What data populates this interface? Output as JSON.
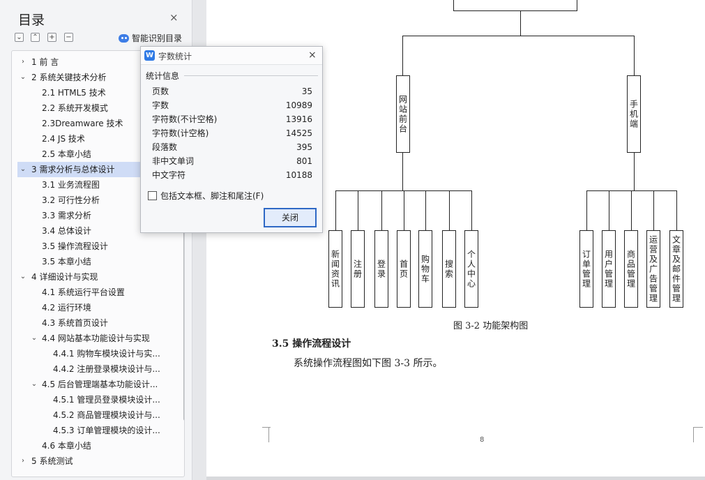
{
  "toc": {
    "title": "目录",
    "close_icon": "×",
    "toolbar_icons": [
      "collapse-all-icon",
      "expand-icon",
      "add-icon",
      "remove-icon"
    ],
    "smart_toc_label": "智能识别目录",
    "items": [
      {
        "chev": "›",
        "label": "1 前   言",
        "level": 1
      },
      {
        "chev": "⌄",
        "label": "2  系统关键技术分析",
        "level": 1
      },
      {
        "chev": "",
        "label": "2.1 HTML5 技术",
        "level": 2
      },
      {
        "chev": "",
        "label": "2.2 系统开发模式",
        "level": 2
      },
      {
        "chev": "",
        "label": "2.3Dreamware 技术",
        "level": 2
      },
      {
        "chev": "",
        "label": "2.4 JS 技术",
        "level": 2
      },
      {
        "chev": "",
        "label": "2.5  本章小结",
        "level": 2
      },
      {
        "chev": "⌄",
        "label": "3  需求分析与总体设计",
        "level": 1,
        "selected": true
      },
      {
        "chev": "",
        "label": "3.1  业务流程图",
        "level": 2
      },
      {
        "chev": "",
        "label": "3.2  可行性分析",
        "level": 2
      },
      {
        "chev": "",
        "label": "3.3  需求分析",
        "level": 2
      },
      {
        "chev": "",
        "label": "3.4  总体设计",
        "level": 2
      },
      {
        "chev": "",
        "label": "3.5  操作流程设计",
        "level": 2
      },
      {
        "chev": "",
        "label": "3.5  本章小结",
        "level": 2
      },
      {
        "chev": "⌄",
        "label": "4  详细设计与实现",
        "level": 1
      },
      {
        "chev": "",
        "label": "4.1  系统运行平台设置",
        "level": 2
      },
      {
        "chev": "",
        "label": "4.2  运行环境",
        "level": 2
      },
      {
        "chev": "",
        "label": "4.3  系统首页设计",
        "level": 2
      },
      {
        "chev": "⌄",
        "label": "4.4  网站基本功能设计与实现",
        "level": 2
      },
      {
        "chev": "",
        "label": "4.4.1  购物车模块设计与实...",
        "level": 3
      },
      {
        "chev": "",
        "label": "4.4.2  注册登录模块设计与...",
        "level": 3
      },
      {
        "chev": "⌄",
        "label": "4.5  后台管理端基本功能设计...",
        "level": 2
      },
      {
        "chev": "",
        "label": "4.5.1  管理员登录模块设计...",
        "level": 3
      },
      {
        "chev": "",
        "label": "4.5.2  商品管理模块设计与...",
        "level": 3
      },
      {
        "chev": "",
        "label": "4.5.3  订单管理模块的设计...",
        "level": 3
      },
      {
        "chev": "",
        "label": "4.6  本章小结",
        "level": 2
      },
      {
        "chev": "›",
        "label": "5  系统测试",
        "level": 1
      }
    ]
  },
  "dialog": {
    "title": "字数统计",
    "close_icon": "×",
    "group_label": "统计信息",
    "stats": [
      {
        "label": "页数",
        "value": "35"
      },
      {
        "label": "字数",
        "value": "10989"
      },
      {
        "label": "字符数(不计空格)",
        "value": "13916"
      },
      {
        "label": "字符数(计空格)",
        "value": "14525"
      },
      {
        "label": "段落数",
        "value": "395"
      },
      {
        "label": "非中文单词",
        "value": "801"
      },
      {
        "label": "中文字符",
        "value": "10188"
      }
    ],
    "checkbox_label": "包括文本框、脚注和尾注(F)",
    "checkbox_checked": false,
    "close_button": "关闭"
  },
  "document": {
    "diagram": {
      "mid_nodes": [
        "网站前台",
        "手机端"
      ],
      "left_leaves": [
        "新闻资讯",
        "注册",
        "登录",
        "首页",
        "购物车",
        "搜索",
        "个人中心"
      ],
      "right_leaves": [
        "订单管理",
        "用户管理",
        "商品管理",
        "运营及广告管理",
        "文章及邮件管理"
      ]
    },
    "figure_caption": "图 3-2 功能架构图",
    "section_heading": "3.5 操作流程设计",
    "section_body": "系统操作流程图如下图 3-3 所示。",
    "page_number": "8"
  }
}
